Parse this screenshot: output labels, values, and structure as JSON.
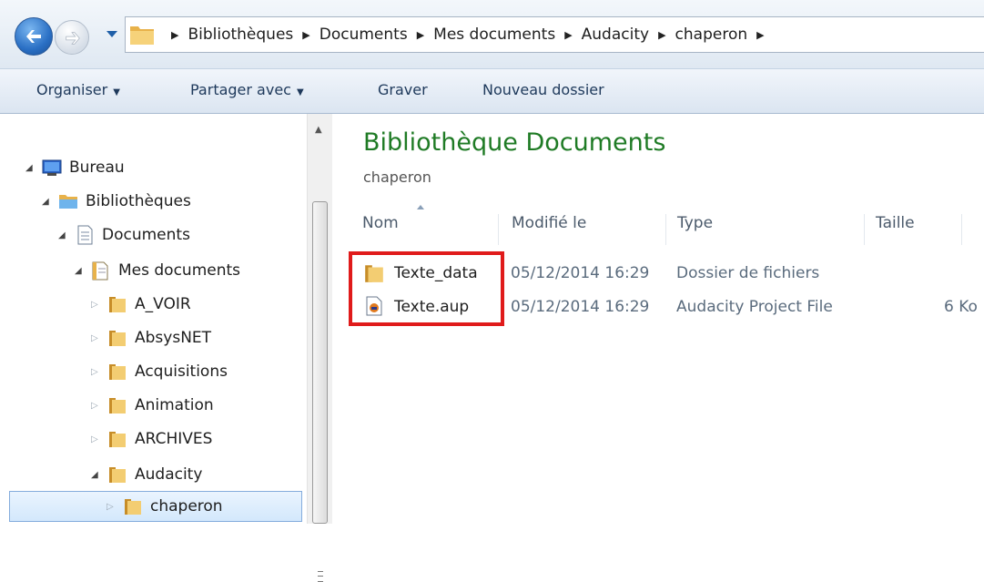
{
  "address_bar": {
    "breadcrumbs": [
      "Bibliothèques",
      "Documents",
      "Mes documents",
      "Audacity",
      "chaperon"
    ]
  },
  "command_bar": {
    "organize": "Organiser",
    "share": "Partager avec",
    "burn": "Graver",
    "new_folder": "Nouveau dossier"
  },
  "nav_tree": [
    {
      "label": "Bureau",
      "icon": "desktop-icon",
      "state": "expanded"
    },
    {
      "label": "Bibliothèques",
      "icon": "libraries-icon",
      "state": "expanded"
    },
    {
      "label": "Documents",
      "icon": "documents-library-icon",
      "state": "expanded"
    },
    {
      "label": "Mes documents",
      "icon": "documents-folder-icon",
      "state": "expanded"
    },
    {
      "label": "A_VOIR",
      "icon": "folder-icon",
      "state": "collapsed"
    },
    {
      "label": "AbsysNET",
      "icon": "folder-icon",
      "state": "collapsed"
    },
    {
      "label": "Acquisitions",
      "icon": "folder-icon",
      "state": "collapsed"
    },
    {
      "label": "Animation",
      "icon": "folder-icon",
      "state": "collapsed"
    },
    {
      "label": "ARCHIVES",
      "icon": "folder-icon",
      "state": "collapsed"
    },
    {
      "label": "Audacity",
      "icon": "folder-icon",
      "state": "expanded"
    },
    {
      "label": "chaperon",
      "icon": "folder-icon",
      "state": "collapsed",
      "selected": true
    }
  ],
  "content": {
    "library_title": "Bibliothèque Documents",
    "subtitle": "chaperon",
    "columns": {
      "name": "Nom",
      "modified": "Modifié le",
      "type": "Type",
      "size": "Taille"
    },
    "files": [
      {
        "name": "Texte_data",
        "icon": "folder-icon",
        "modified": "05/12/2014 16:29",
        "type": "Dossier de fichiers",
        "size": ""
      },
      {
        "name": "Texte.aup",
        "icon": "audacity-file-icon",
        "modified": "05/12/2014 16:29",
        "type": "Audacity Project File",
        "size": "6 Ko"
      }
    ]
  },
  "colors": {
    "title_green": "#1f7b25",
    "highlight_red": "#e01b1b",
    "selection_border": "#84acdd"
  }
}
